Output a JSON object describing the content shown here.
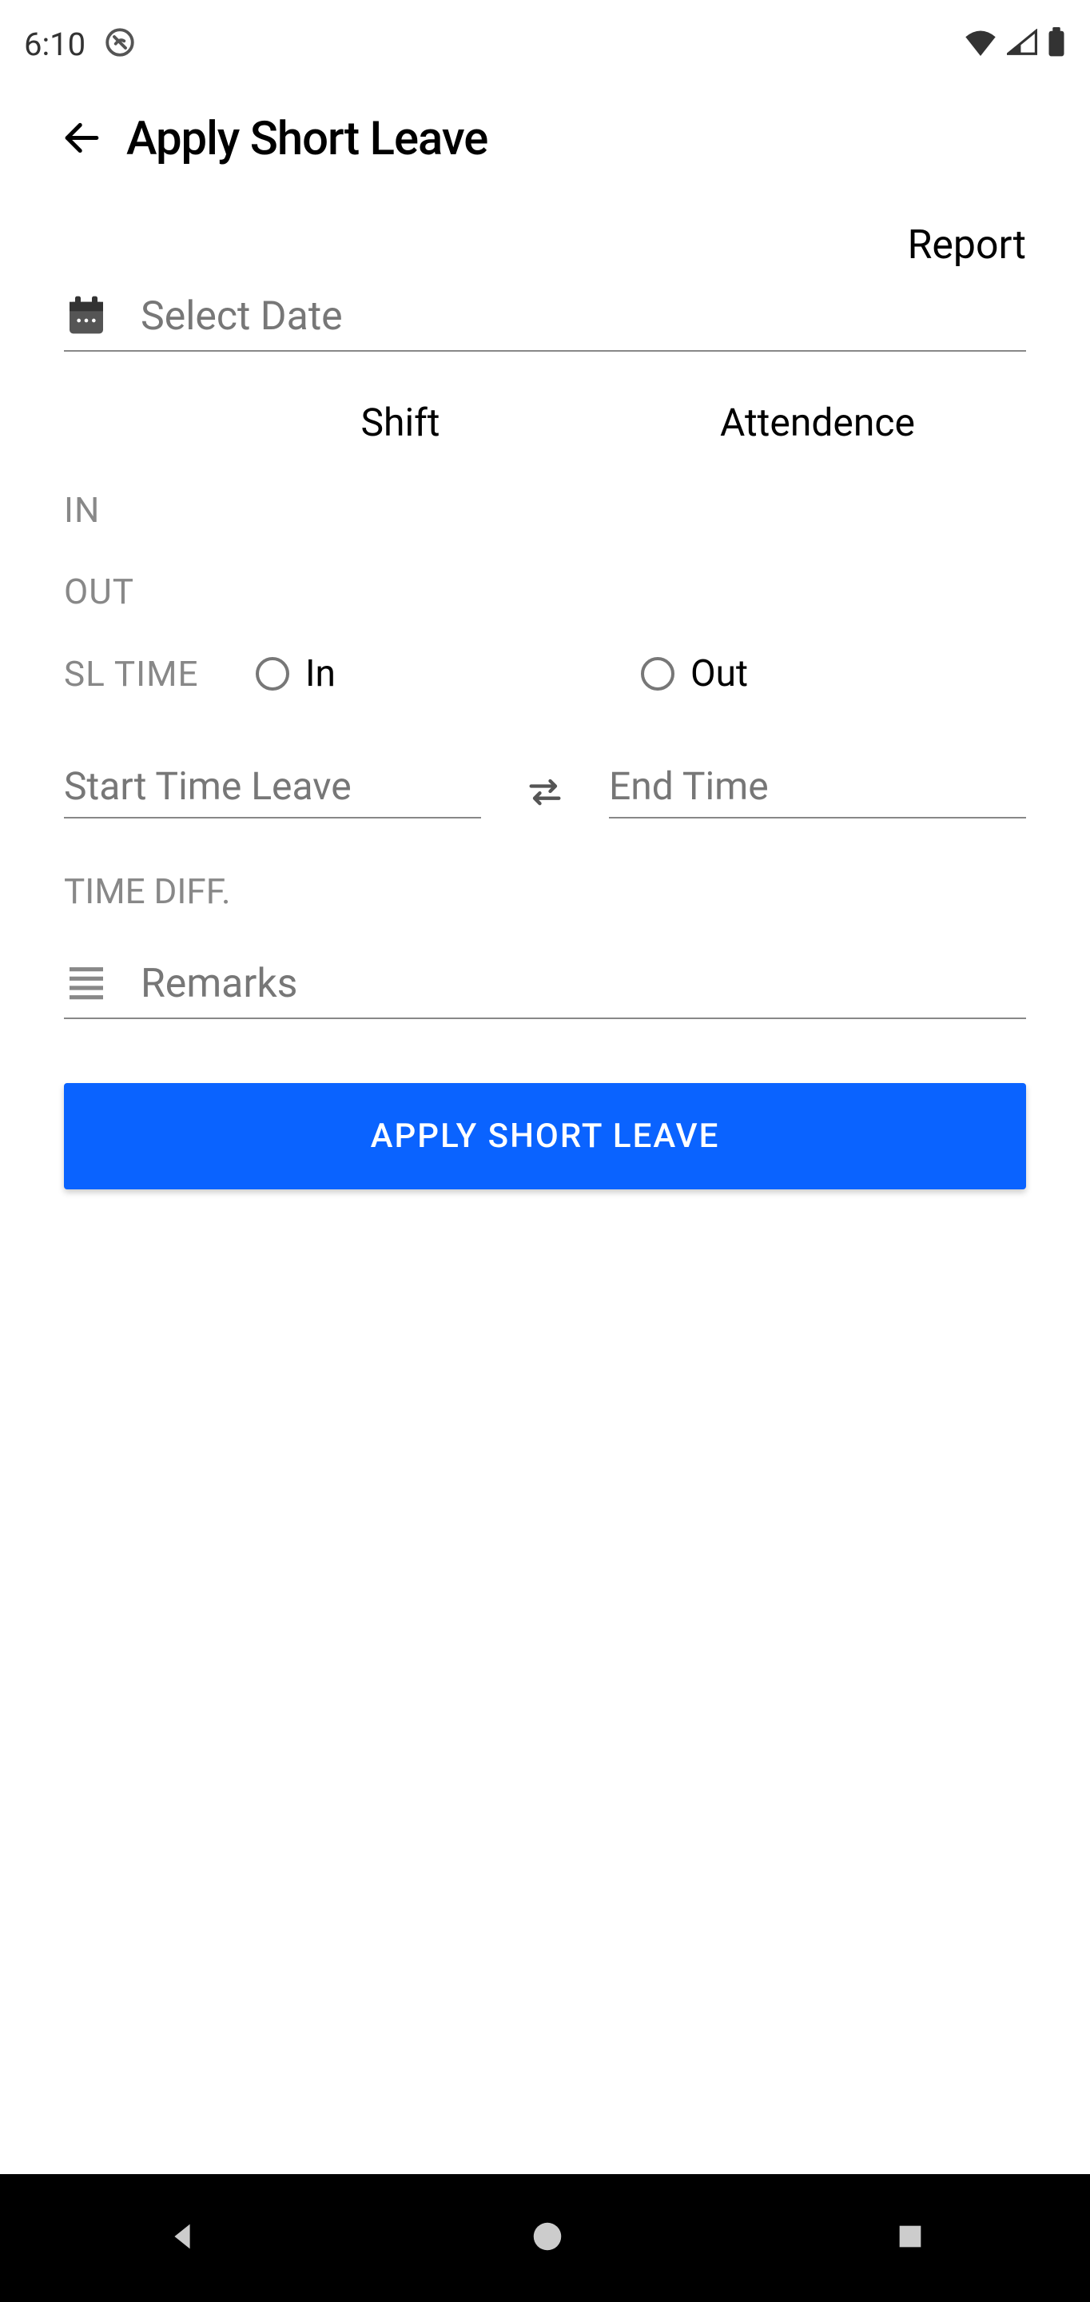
{
  "status": {
    "time": "6:10"
  },
  "header": {
    "title": "Apply Short Leave"
  },
  "report_label": "Report",
  "date": {
    "placeholder": "Select Date"
  },
  "columns": {
    "shift": "Shift",
    "attendance": "Attendence"
  },
  "rows": {
    "in": "IN",
    "out": "OUT",
    "sl_time": "SL TIME"
  },
  "radio": {
    "in": "In",
    "out": "Out"
  },
  "time": {
    "start_placeholder": "Start Time Leave",
    "end_placeholder": "End Time"
  },
  "time_diff_label": "TIME DIFF.",
  "remarks": {
    "placeholder": "Remarks"
  },
  "button": {
    "apply": "APPLY SHORT LEAVE"
  }
}
